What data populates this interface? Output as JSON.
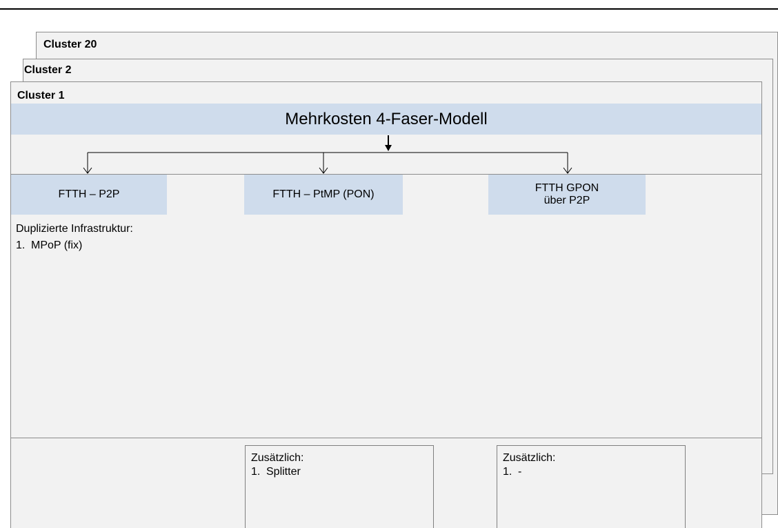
{
  "clusters": {
    "back": "Cluster 20",
    "middle": "Cluster 2",
    "front": "Cluster 1"
  },
  "banner": "Mehrkosten 4-Faser-Modell",
  "options": [
    {
      "label": "FTTH – P2P"
    },
    {
      "label": "FTTH – PtMP (PON)"
    },
    {
      "label": "FTTH GPON über P2P"
    }
  ],
  "p2p_notes": {
    "heading": "Duplizierte Infrastruktur:",
    "items": [
      {
        "num": "1.",
        "text": "MPoP (fix)"
      }
    ]
  },
  "additional": [
    {
      "heading": "Zusätzlich:",
      "num": "1.",
      "text": "Splitter"
    },
    {
      "heading": "Zusätzlich:",
      "num": "1.",
      "text": "-"
    }
  ]
}
